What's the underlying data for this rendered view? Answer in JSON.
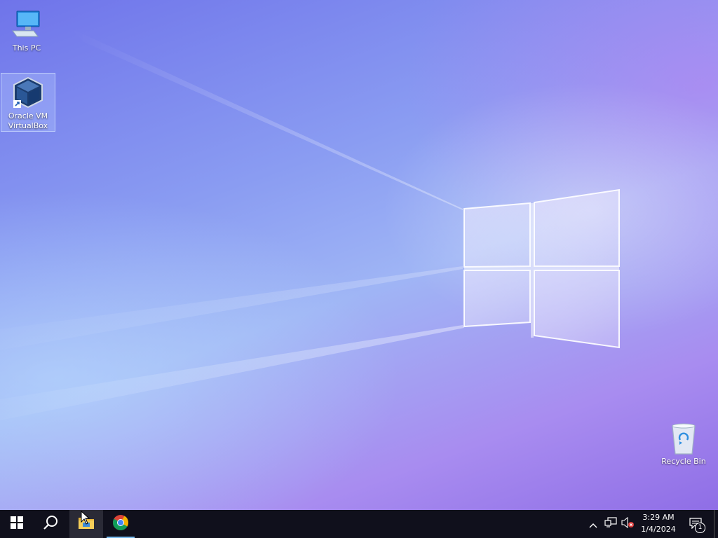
{
  "desktop": {
    "icons": [
      {
        "label": "This PC",
        "icon": "this-pc-icon"
      },
      {
        "label": "Oracle VM VirtualBox",
        "icon": "virtualbox-icon",
        "selected": true
      },
      {
        "label": "Recycle Bin",
        "icon": "recycle-bin-icon"
      }
    ]
  },
  "taskbar": {
    "start": {
      "icon": "windows-start-icon"
    },
    "search": {
      "icon": "search-icon"
    },
    "pinned": [
      {
        "name": "File Explorer",
        "icon": "file-explorer-icon"
      },
      {
        "name": "Google Chrome",
        "icon": "chrome-icon",
        "running": true
      }
    ],
    "tray": {
      "chevron": "chevron-up-icon",
      "network": "network-icon",
      "volume": "volume-muted-icon",
      "time": "3:29 AM",
      "date": "1/4/2024",
      "notifications": {
        "icon": "action-center-icon",
        "count": "1"
      }
    }
  },
  "colors": {
    "taskbar_bg": "#10101c",
    "accent": "#76b9ed"
  }
}
